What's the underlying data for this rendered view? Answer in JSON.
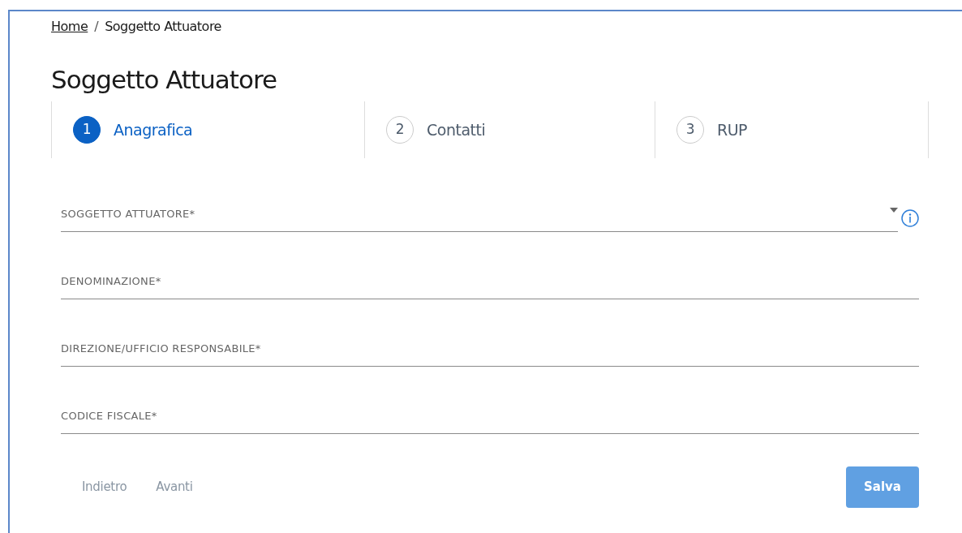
{
  "breadcrumb": [
    {
      "label": "Home",
      "kind": "link"
    },
    {
      "label": "/",
      "kind": "separator"
    },
    {
      "label": "Soggetto Attuatore",
      "kind": "current"
    }
  ],
  "title": "Soggetto Attuatore",
  "steps": [
    {
      "number": "1",
      "label": "Anagrafica",
      "selected": true
    },
    {
      "number": "2",
      "label": "Contatti",
      "selected": false
    },
    {
      "number": "3",
      "label": "RUP",
      "selected": false
    }
  ],
  "fields": [
    {
      "kind": "select",
      "placeholder": "SOGGETTO ATTUATORE*",
      "info": true
    },
    {
      "kind": "text",
      "placeholder": "DENOMINAZIONE*",
      "info": false
    },
    {
      "kind": "text",
      "placeholder": "DIREZIONE/UFFICIO RESPONSABILE*",
      "info": false
    },
    {
      "kind": "text",
      "placeholder": "CODICE FISCALE*",
      "info": false
    }
  ],
  "actions": [
    {
      "label": "Indietro",
      "kind": "link",
      "disabled": true
    },
    {
      "label": "Avanti",
      "kind": "link",
      "disabled": true
    },
    {
      "label": "Salva",
      "kind": "primary",
      "disabled": true
    }
  ]
}
